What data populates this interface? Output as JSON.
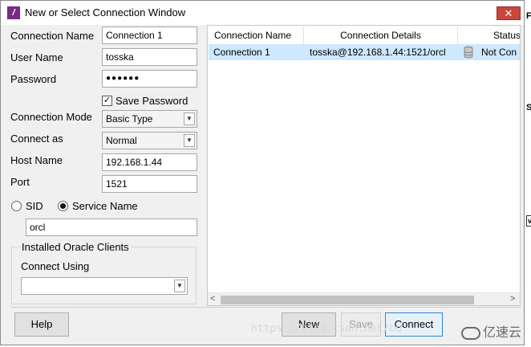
{
  "window": {
    "title": "New or Select Connection Window",
    "close_label": "✕"
  },
  "form": {
    "connection_name": {
      "label": "Connection Name",
      "value": "Connection 1"
    },
    "user_name": {
      "label": "User Name",
      "value": "tosska"
    },
    "password": {
      "label": "Password",
      "value": "●●●●●●"
    },
    "save_password": {
      "label": "Save Password",
      "checked": true,
      "mark": "✓"
    },
    "connection_mode": {
      "label": "Connection Mode",
      "value": "Basic Type"
    },
    "connect_as": {
      "label": "Connect as",
      "value": "Normal"
    },
    "host_name": {
      "label": "Host Name",
      "value": "192.168.1.44"
    },
    "port": {
      "label": "Port",
      "value": "1521"
    },
    "sid_option": {
      "label": "SID",
      "selected": false
    },
    "service_name_option": {
      "label": "Service Name",
      "selected": true
    },
    "service_value": "orcl",
    "installed_clients": {
      "title": "Installed Oracle Clients",
      "connect_using_label": "Connect Using",
      "value": ""
    }
  },
  "grid": {
    "columns": [
      "Connection Name",
      "Connection Details",
      "Status"
    ],
    "rows": [
      {
        "name": "Connection 1",
        "details": "tosska@192.168.1.44:1521/orcl",
        "status": "Not Con"
      }
    ],
    "scroll_left": "<",
    "scroll_right": ">"
  },
  "buttons": {
    "help": "Help",
    "new": "New",
    "save": "Save",
    "connect": "Connect"
  },
  "watermark": "https://blog.csdn.net/bu",
  "logo": "亿速云",
  "side_chars": [
    "F",
    "S",
    "v"
  ],
  "colors": {
    "selection": "#cde8ff",
    "close": "#c9463d",
    "primary_border": "#2f86d6"
  }
}
